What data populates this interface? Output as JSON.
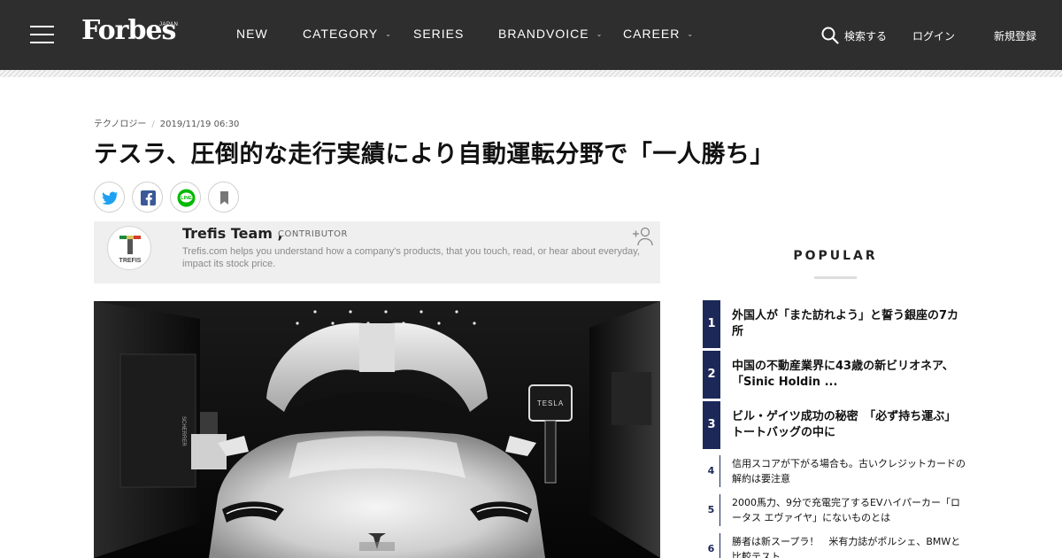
{
  "header": {
    "logo": "Forbes",
    "logo_sub": "JAPAN",
    "nav": [
      {
        "label": "NEW",
        "dropdown": false
      },
      {
        "label": "CATEGORY",
        "dropdown": true
      },
      {
        "label": "SERIES",
        "dropdown": false
      },
      {
        "label": "BRANDVOICE",
        "dropdown": true
      },
      {
        "label": "CAREER",
        "dropdown": true
      }
    ],
    "search_label": "検索する",
    "login_label": "ログイン",
    "register_label": "新規登録",
    "chevron": "⌄"
  },
  "article": {
    "category": "テクノロジー",
    "separator": "/",
    "date": "2019/11/19 06:30",
    "title": "テスラ、圧倒的な走行実績により自動運転分野で「一人勝ち」",
    "author": {
      "name": "Trefis Team ,",
      "role": "CONTRIBUTOR",
      "logo_text": "TREFIS",
      "description": "Trefis.com helps you understand how a company's products, that you touch, read, or hear about everyday, impact its stock price."
    },
    "share": [
      {
        "name": "twitter",
        "color": "#1da1f2"
      },
      {
        "name": "facebook",
        "color": "#3b5998"
      },
      {
        "name": "line",
        "color": "#00b900"
      },
      {
        "name": "bookmark",
        "color": "#777777"
      }
    ],
    "hero_signs": {
      "tesla": "TESLA",
      "showroom": "SCHERRER"
    }
  },
  "sidebar": {
    "popular_title": "POPULAR",
    "accent": "#1c2958",
    "items": [
      {
        "rank": "1",
        "title": "外国人が「また訪れよう」と誓う銀座の7カ所"
      },
      {
        "rank": "2",
        "title": "中国の不動産業界に43歳の新ビリオネア、「Sinic Holdin ..."
      },
      {
        "rank": "3",
        "title": "ビル・ゲイツ成功の秘密　「必ず持ち運ぶ」トートバッグの中に"
      },
      {
        "rank": "4",
        "title": "信用スコアが下がる場合も。古いクレジットカードの解約は要注意"
      },
      {
        "rank": "5",
        "title": "2000馬力、9分で充電完了するEVハイパーカー「ロータス エヴァイヤ」にないものとは"
      },
      {
        "rank": "6",
        "title": "勝者は新スープラ！　米有力誌がポルシェ、BMWと比較テスト"
      }
    ]
  }
}
